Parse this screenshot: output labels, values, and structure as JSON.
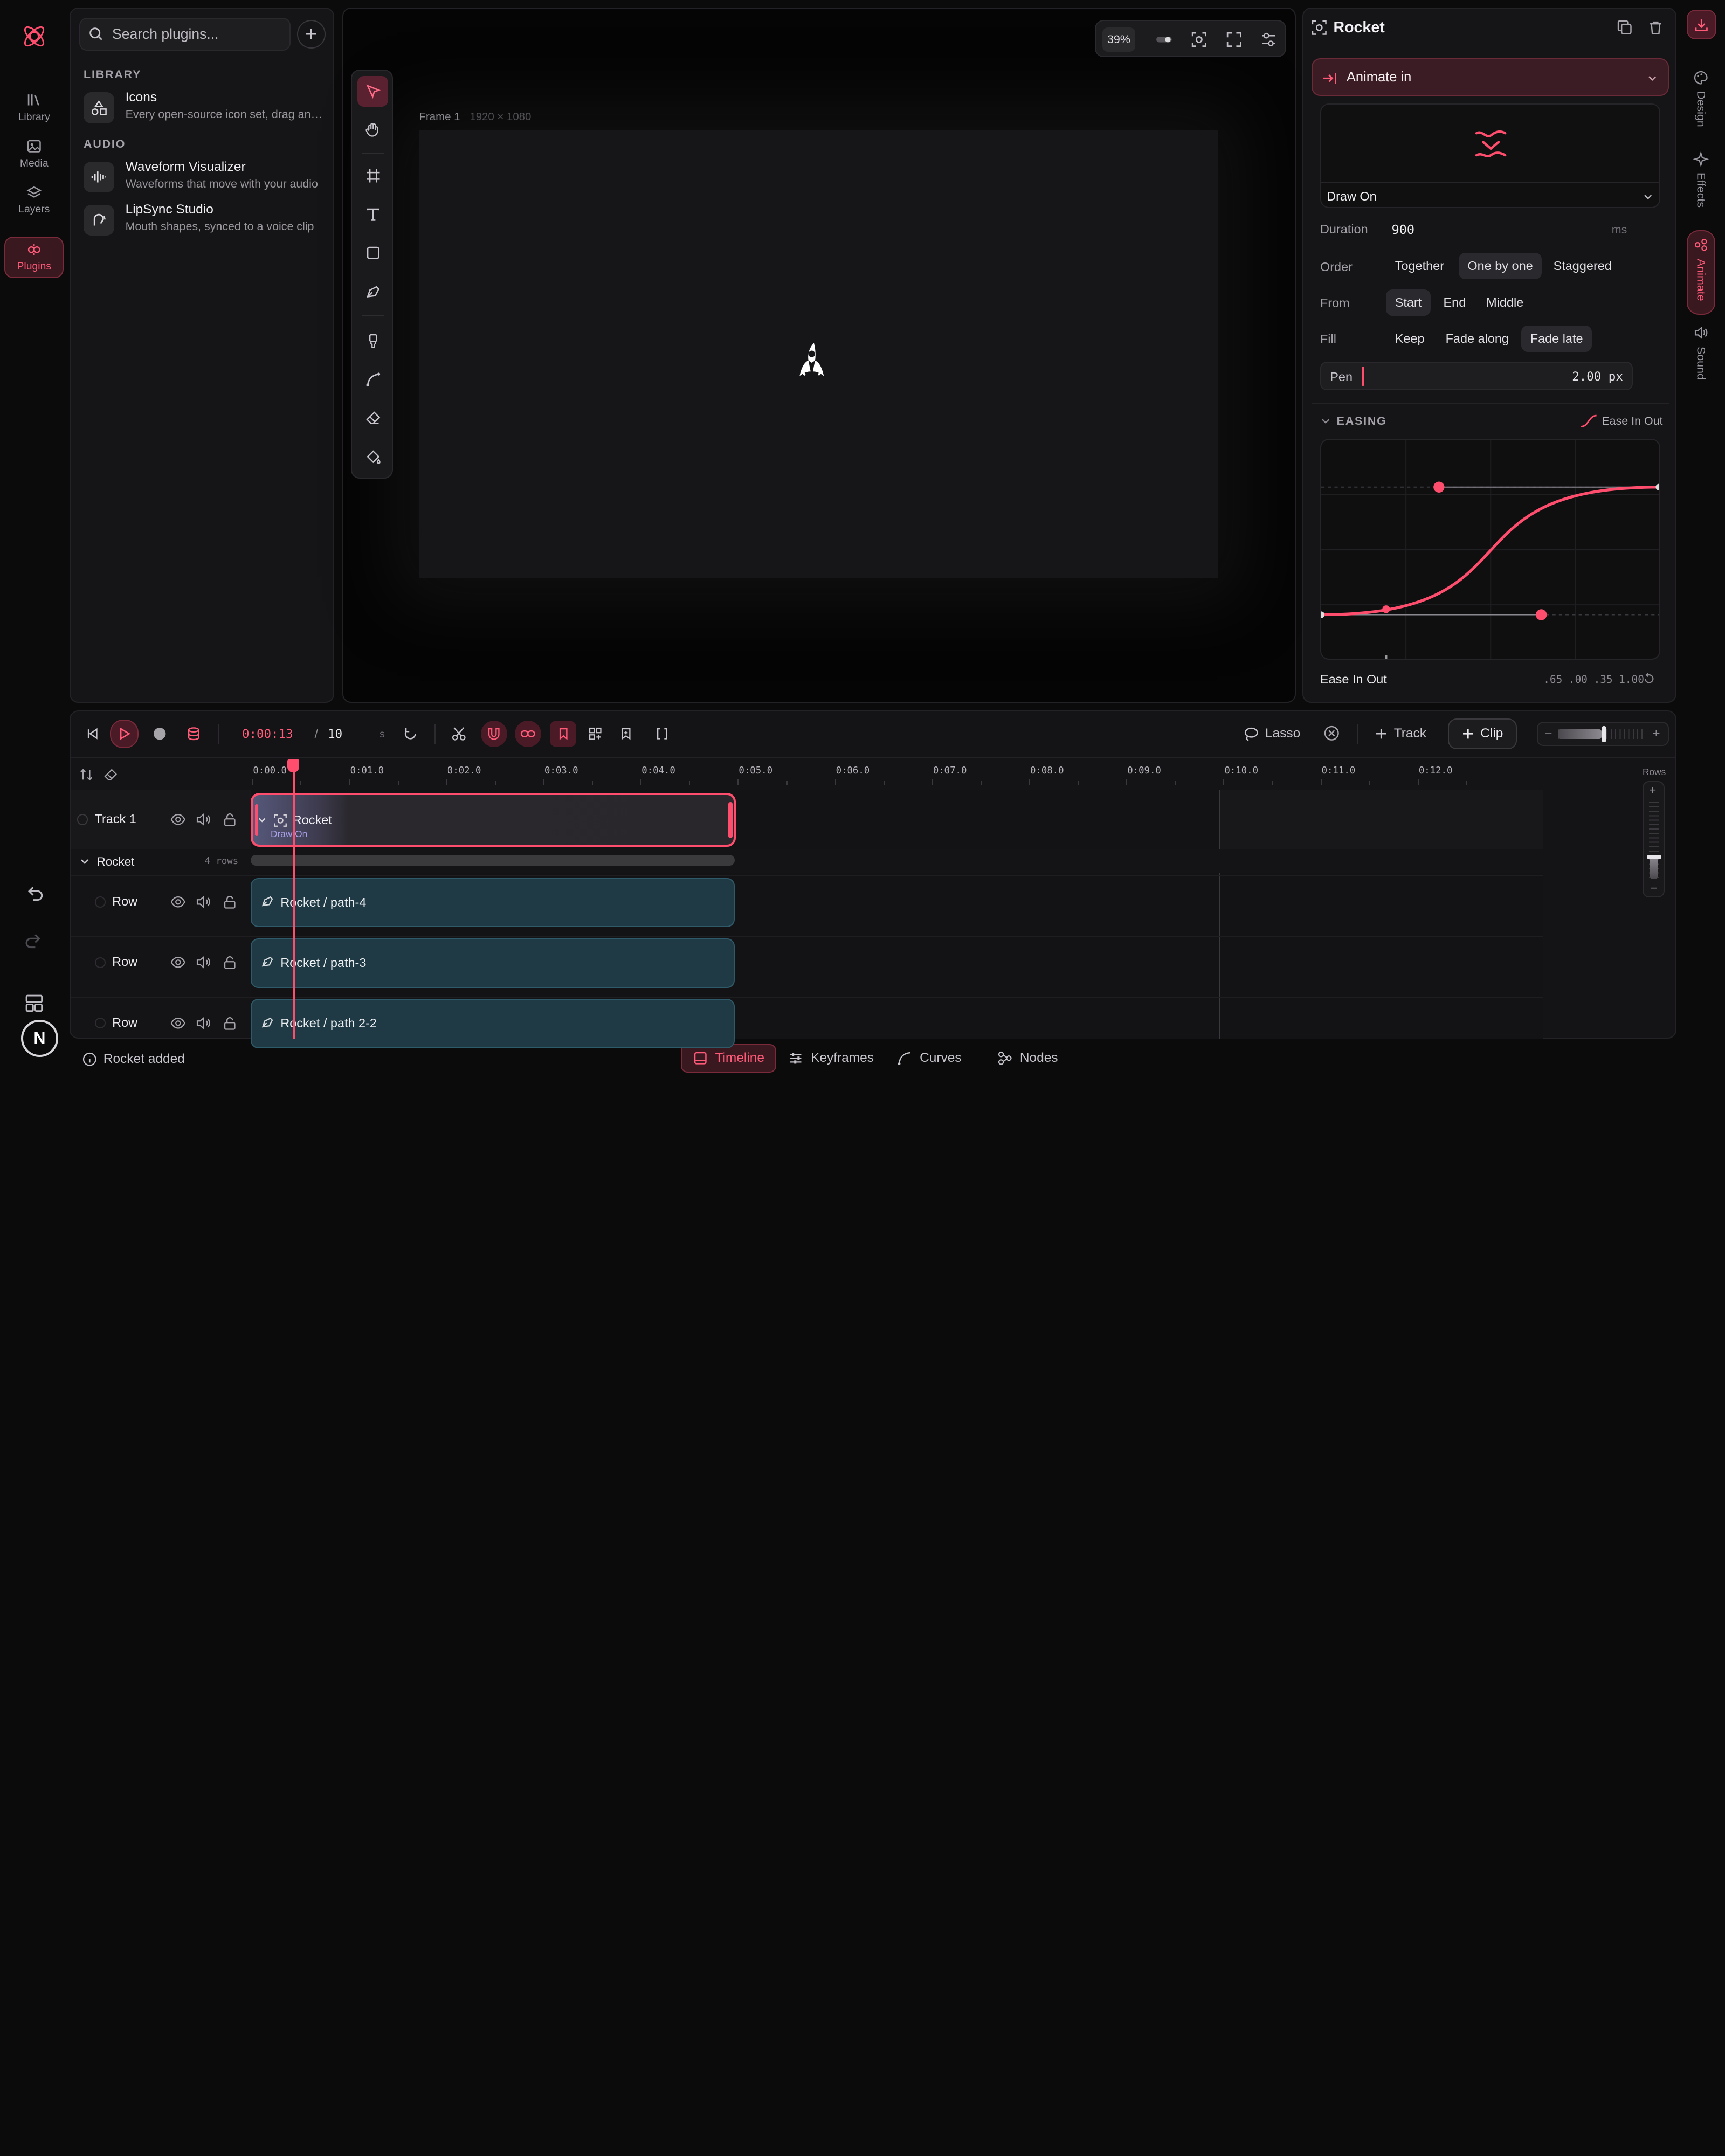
{
  "rail": {
    "items": [
      {
        "label": "Library",
        "icon": "library-icon"
      },
      {
        "label": "Media",
        "icon": "image-icon"
      },
      {
        "label": "Layers",
        "icon": "layers-icon"
      },
      {
        "label": "Plugins",
        "icon": "plugin-icon",
        "active": true
      }
    ],
    "avatar_letter": "N"
  },
  "plugins": {
    "search_placeholder": "Search plugins...",
    "sections": [
      {
        "title": "LIBRARY",
        "items": [
          {
            "name": "Icons",
            "desc": "Every open-source icon set, drag and drop",
            "icon": "shapes-icon"
          }
        ]
      },
      {
        "title": "AUDIO",
        "items": [
          {
            "name": "Waveform Visualizer",
            "desc": "Waveforms that move with your audio",
            "icon": "waveform-icon"
          },
          {
            "name": "LipSync Studio",
            "desc": "Mouth shapes, synced to a voice clip",
            "icon": "face-icon"
          }
        ]
      }
    ]
  },
  "canvas": {
    "frame_name": "Frame 1",
    "frame_size": "1920 × 1080",
    "zoom": "39%"
  },
  "inspector": {
    "title": "Rocket",
    "animate_dropdown": "Animate in",
    "preset": "Draw On",
    "duration_label": "Duration",
    "duration_value": "900",
    "duration_unit": "ms",
    "order_label": "Order",
    "order_options": [
      "Together",
      "One by one",
      "Staggered"
    ],
    "order_selected": 1,
    "from_label": "From",
    "from_options": [
      "Start",
      "End",
      "Middle"
    ],
    "from_selected": 0,
    "fill_label": "Fill",
    "fill_options": [
      "Keep",
      "Fade along",
      "Fade late"
    ],
    "fill_selected": 2,
    "pen_label": "Pen",
    "pen_value": "2.00 px",
    "easing_header": "EASING",
    "easing_preset": "Ease In Out",
    "easing_name": "Ease In Out",
    "easing_values": ".65 .00 .35 1.00",
    "accent": "#ff4d6d"
  },
  "side_tabs": [
    {
      "label": "Design",
      "icon": "palette-icon"
    },
    {
      "label": "Effects",
      "icon": "sparkle-icon"
    },
    {
      "label": "Animate",
      "icon": "animate-icon",
      "active": true
    },
    {
      "label": "Sound",
      "icon": "speaker-icon"
    }
  ],
  "timeline": {
    "current_time": "0:00:13",
    "separator": "/",
    "total": "10",
    "unit": "s",
    "lasso": "Lasso",
    "add_track": "Track",
    "add_clip": "Clip",
    "rows_label": "Rows",
    "ticks": [
      "0:00.0",
      "0:01.0",
      "0:02.0",
      "0:03.0",
      "0:04.0",
      "0:05.0",
      "0:06.0",
      "0:07.0",
      "0:08.0",
      "0:09.0",
      "0:10.0",
      "0:11.0",
      "0:12.0"
    ],
    "track": {
      "name": "Track 1",
      "clip_name": "Rocket",
      "clip_sub": "Draw On"
    },
    "group": {
      "name": "Rocket",
      "count": "4 rows"
    },
    "rows": [
      {
        "label": "Row",
        "clip": "Rocket / path-4"
      },
      {
        "label": "Row",
        "clip": "Rocket / path-3"
      },
      {
        "label": "Row",
        "clip": "Rocket / path 2-2"
      }
    ]
  },
  "statusbar": {
    "message": "Rocket added",
    "tabs": [
      {
        "label": "Timeline",
        "icon": "timeline-icon",
        "active": true
      },
      {
        "label": "Keyframes",
        "icon": "sliders-icon"
      },
      {
        "label": "Curves",
        "icon": "curve-icon"
      },
      {
        "label": "Nodes",
        "icon": "nodes-icon"
      }
    ]
  }
}
